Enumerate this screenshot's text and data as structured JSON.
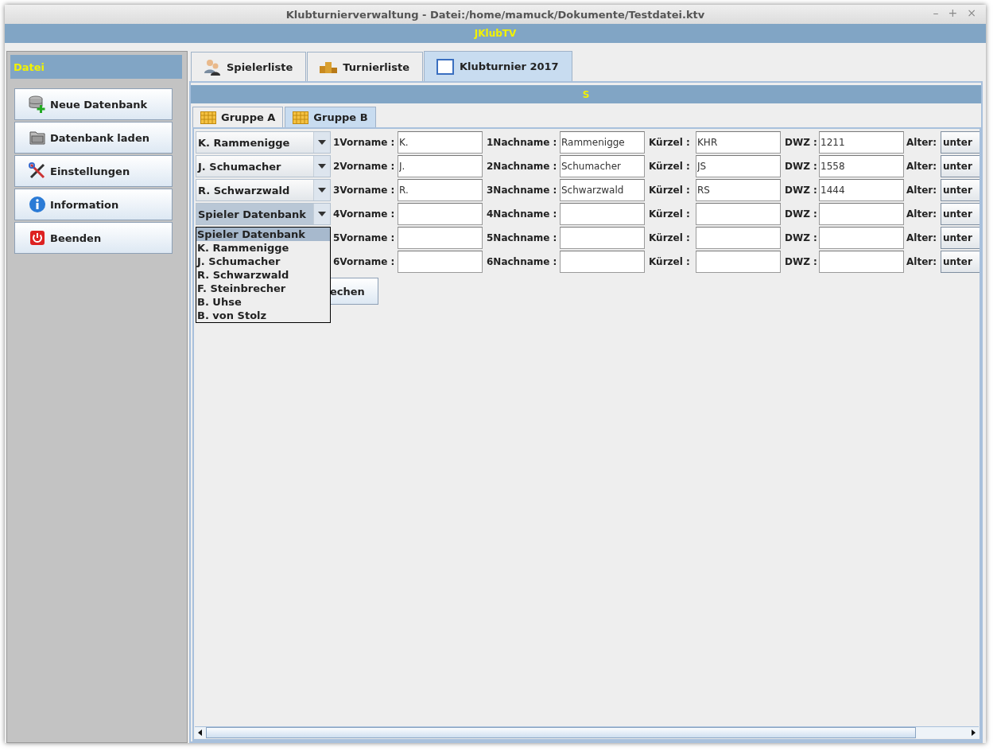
{
  "window": {
    "title": "Klubturnierverwaltung - Datei:/home/mamuck/Dokumente/Testdatei.ktv",
    "controls": [
      "–",
      "+",
      "×"
    ]
  },
  "app_banner": "JKlubTV",
  "sidebar": {
    "title": "Datei",
    "items": [
      {
        "label": "Neue Datenbank",
        "kind": "database"
      },
      {
        "label": "Datenbank laden",
        "kind": "folder"
      },
      {
        "label": "Einstellungen",
        "kind": "tools"
      },
      {
        "label": "Information",
        "kind": "info"
      },
      {
        "label": "Beenden",
        "kind": "power"
      }
    ]
  },
  "tabs": [
    {
      "label": "Spielerliste",
      "kind": "people",
      "selected": false
    },
    {
      "label": "Turnierliste",
      "kind": "podium",
      "selected": false
    },
    {
      "label": "Klubturnier 2017",
      "kind": "window",
      "selected": true
    }
  ],
  "section_banner": "S",
  "group_tabs": [
    {
      "label": "Gruppe A",
      "selected": false
    },
    {
      "label": "Gruppe B",
      "selected": true
    }
  ],
  "players": [
    {
      "combo": "K. Rammenigge",
      "open": false,
      "first_label": "1Vorname :",
      "first": "K.",
      "last_label": "1Nachname :",
      "last": "Rammenigge",
      "short_label": "Kürzel :",
      "short": "KHR",
      "dwz_label": "DWZ :",
      "dwz": "1211",
      "age_label": "Alter:",
      "age": "unter"
    },
    {
      "combo": "J. Schumacher",
      "open": false,
      "first_label": "2Vorname :",
      "first": "J.",
      "last_label": "2Nachname :",
      "last": "Schumacher",
      "short_label": "Kürzel :",
      "short": "JS",
      "dwz_label": "DWZ :",
      "dwz": "1558",
      "age_label": "Alter:",
      "age": "unter"
    },
    {
      "combo": "R. Schwarzwald",
      "open": false,
      "first_label": "3Vorname :",
      "first": "R.",
      "last_label": "3Nachname :",
      "last": "Schwarzwald",
      "short_label": "Kürzel :",
      "short": "RS",
      "dwz_label": "DWZ :",
      "dwz": "1444",
      "age_label": "Alter:",
      "age": "unter"
    },
    {
      "combo": "Spieler Datenbank",
      "open": true,
      "first_label": "4Vorname :",
      "last_label": "4Nachname :",
      "short_label": "Kürzel :",
      "dwz_label": "DWZ :",
      "age_label": "Alter:",
      "age": "unter"
    },
    {
      "first_label": "5Vorname :",
      "last_label": "5Nachname :",
      "short_label": "Kürzel :",
      "dwz_label": "DWZ :",
      "age_label": "Alter:",
      "age": "unter"
    },
    {
      "first_label": "6Vorname :",
      "last_label": "6Nachname :",
      "short_label": "Kürzel :",
      "dwz_label": "DWZ :",
      "age_label": "Alter:",
      "age": "unter"
    }
  ],
  "combo_popup": {
    "items": [
      {
        "label": "Spieler Datenbank",
        "selected": true
      },
      {
        "label": "K. Rammenigge",
        "selected": false
      },
      {
        "label": "J. Schumacher",
        "selected": false
      },
      {
        "label": "R. Schwarzwald",
        "selected": false
      },
      {
        "label": "F. Steinbrecher",
        "selected": false
      },
      {
        "label": "B. Uhse",
        "selected": false
      },
      {
        "label": "B. von Stolz",
        "selected": false
      }
    ]
  },
  "action_button": {
    "label": "echen"
  }
}
